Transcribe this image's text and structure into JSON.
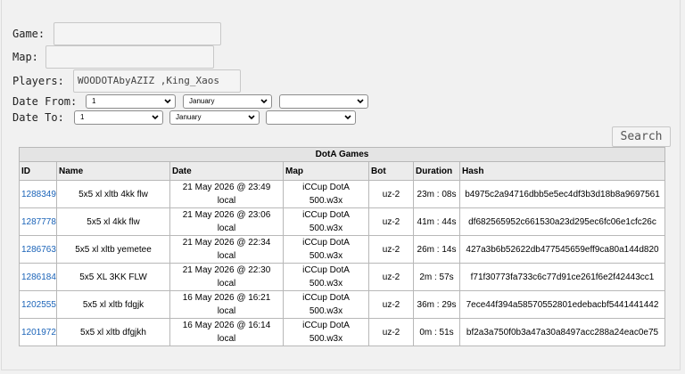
{
  "form": {
    "game_label": "Game:",
    "map_label": "Map:",
    "players_label": "Players:",
    "players_value": "WOODOTAbyAZIZ ,King_Xaos",
    "date_from_label": "Date From:",
    "date_to_label": "Date To:",
    "from_day": "1",
    "from_month": "January",
    "from_year": "",
    "to_day": "1",
    "to_month": "January",
    "to_year": "",
    "search_label": "Search"
  },
  "table": {
    "caption": "DotA Games",
    "headers": [
      "ID",
      "Name",
      "Date",
      "Map",
      "Bot",
      "Duration",
      "Hash"
    ],
    "rows": [
      {
        "id": "1288349",
        "name": "5x5 xl xltb 4kk flw",
        "date1": "21 May 2026 @ 23:49",
        "date2": "local",
        "map1": "iCCup DotA",
        "map2": "500.w3x",
        "bot": "uz-2",
        "duration": "23m : 08s",
        "hash": "b4975c2a94716dbb5e5ec4df3b3d18b8a9697561"
      },
      {
        "id": "1287778",
        "name": "5x5 xl 4kk flw",
        "date1": "21 May 2026 @ 23:06",
        "date2": "local",
        "map1": "iCCup DotA",
        "map2": "500.w3x",
        "bot": "uz-2",
        "duration": "41m : 44s",
        "hash": "df682565952c661530a23d295ec6fc06e1cfc26c"
      },
      {
        "id": "1286763",
        "name": "5x5 xl xltb yemetee",
        "date1": "21 May 2026 @ 22:34",
        "date2": "local",
        "map1": "iCCup DotA",
        "map2": "500.w3x",
        "bot": "uz-2",
        "duration": "26m : 14s",
        "hash": "427a3b6b52622db477545659eff9ca80a144d820"
      },
      {
        "id": "1286184",
        "name": "5x5 XL 3KK FLW",
        "date1": "21 May 2026 @ 22:30",
        "date2": "local",
        "map1": "iCCup DotA",
        "map2": "500.w3x",
        "bot": "uz-2",
        "duration": "2m : 57s",
        "hash": "f71f30773fa733c6c77d91ce261f6e2f42443cc1"
      },
      {
        "id": "1202555",
        "name": "5x5 xl xltb fdgjk",
        "date1": "16 May 2026 @ 16:21",
        "date2": "local",
        "map1": "iCCup DotA",
        "map2": "500.w3x",
        "bot": "uz-2",
        "duration": "36m : 29s",
        "hash": "7ece44f394a58570552801edebacbf5441441442"
      },
      {
        "id": "1201972",
        "name": "5x5 xl xltb dfgjkh",
        "date1": "16 May 2026 @ 16:14",
        "date2": "local",
        "map1": "iCCup DotA",
        "map2": "500.w3x",
        "bot": "uz-2",
        "duration": "0m : 51s",
        "hash": "bf2a3a750f0b3a47a30a8497acc288a24eac0e75"
      }
    ]
  }
}
